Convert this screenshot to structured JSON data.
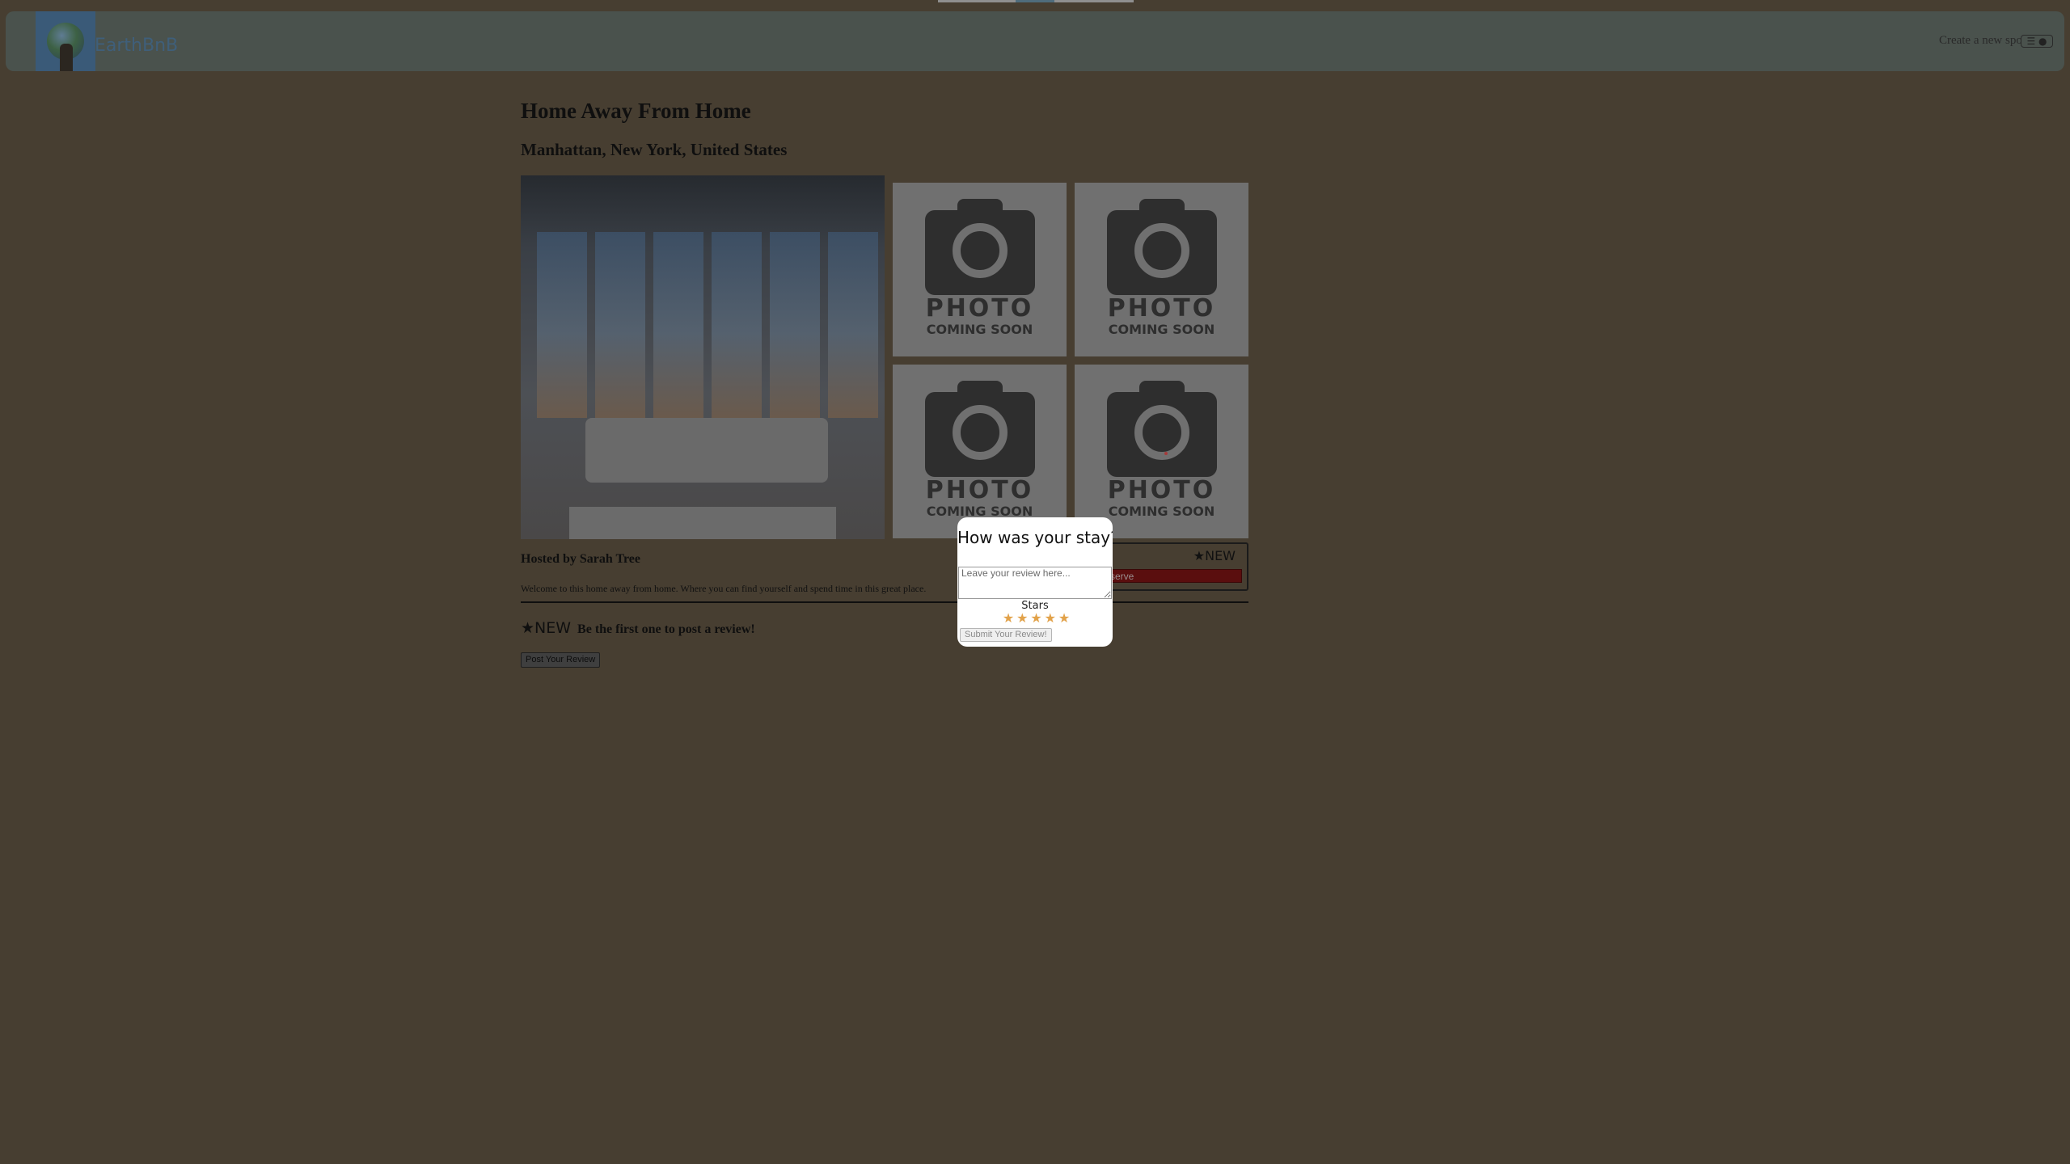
{
  "header": {
    "brand": "EarthBnB",
    "create_spot_link": "Create a new spot",
    "menu_icon": "hamburger-icon",
    "profile_icon": "user-icon"
  },
  "listing": {
    "title": "Home Away From Home",
    "location": "Manhattan, New York, United States",
    "host": "Hosted by Sarah Tree",
    "description": "Welcome to this home away from home. Where you can find yourself and spend time in this great place."
  },
  "placeholder_photo": {
    "line1": "PHOTO",
    "line2": "COMING SOON"
  },
  "reserve_card": {
    "price": "$",
    "rating": "★NEW",
    "reserve_label": "Reserve"
  },
  "reviews": {
    "new_tag": "★NEW",
    "summary": "Be the first one to post a review!",
    "post_button": "Post Your Review"
  },
  "review_modal": {
    "title": "How was your stay?",
    "placeholder": "Leave your review here...",
    "stars_label": "Stars",
    "star_count": 5,
    "submit_label": "Submit Your Review!"
  },
  "colors": {
    "overlay_background": "#473e31",
    "modal_background": "#ffffff",
    "star_color": "#e2a24a",
    "reserve_button": "#5a0e0e"
  }
}
